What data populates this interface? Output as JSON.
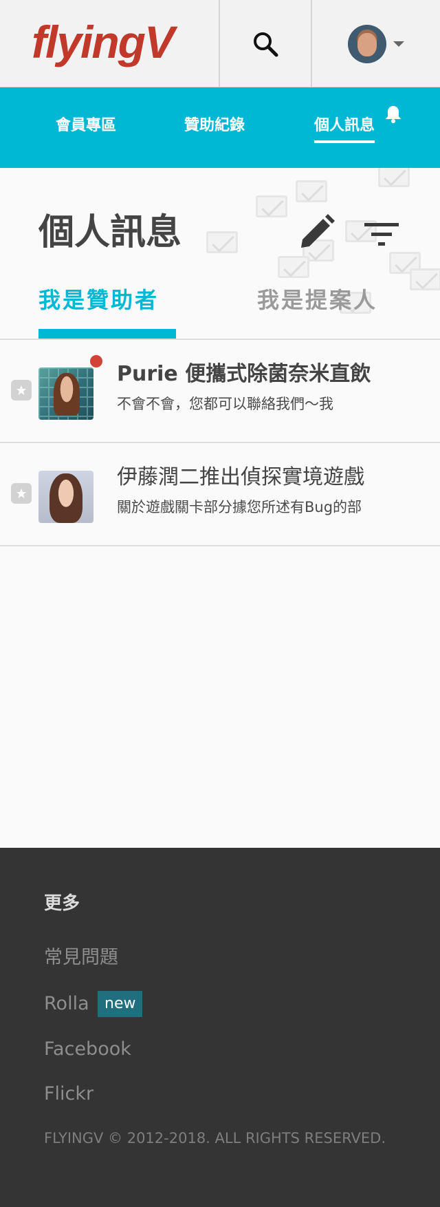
{
  "header": {
    "logo_text": "flyingV",
    "logo_color": "#c0392b",
    "search_icon": "search-icon",
    "avatar_icon": "avatar"
  },
  "nav": {
    "background": "#00b8d4",
    "items": [
      {
        "label": "會員專區",
        "active": false
      },
      {
        "label": "贊助紀錄",
        "active": false
      },
      {
        "label": "個人訊息",
        "active": true
      }
    ],
    "notification_icon": "bell-icon"
  },
  "main": {
    "title": "個人訊息",
    "edit_icon": "pencil-icon",
    "filter_icon": "filter-icon",
    "tabs": [
      {
        "label": "我是贊助者",
        "active": true
      },
      {
        "label": "我是提案人",
        "active": false
      }
    ],
    "messages": [
      {
        "title": "Purie 便攜式除菌奈米直飲",
        "preview": "不會不會，您都可以聯絡我們～我",
        "unread": true
      },
      {
        "title": "伊藤潤二推出偵探實境遊戲",
        "preview": "關於遊戲關卡部分據您所述有Bug的部",
        "unread": false
      }
    ]
  },
  "footer": {
    "heading": "更多",
    "links": [
      {
        "label": "常見問題"
      },
      {
        "label": "Rolla",
        "badge": "new"
      },
      {
        "label": "Facebook"
      },
      {
        "label": "Flickr"
      }
    ],
    "copyright": "FLYINGV © 2012-2018. ALL RIGHTS RESERVED."
  }
}
